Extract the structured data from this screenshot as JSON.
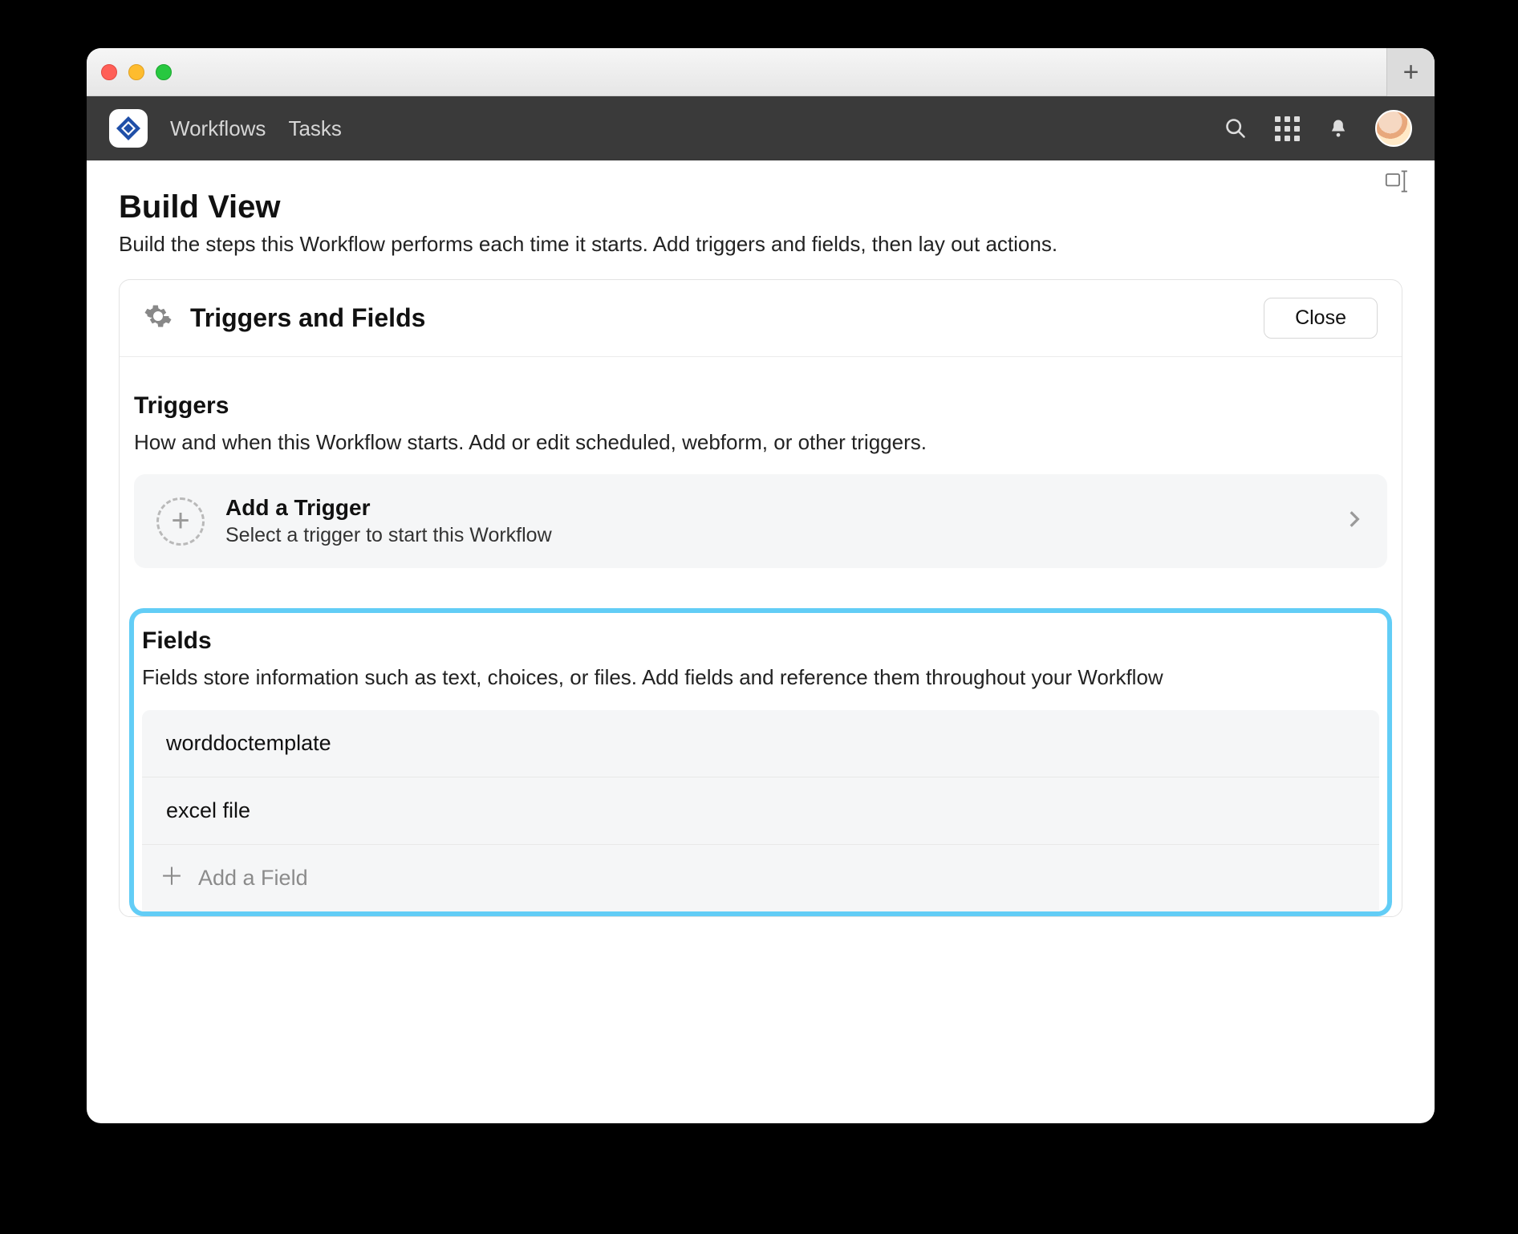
{
  "nav": {
    "workflows": "Workflows",
    "tasks": "Tasks"
  },
  "page": {
    "title": "Build View",
    "subtitle": "Build the steps this Workflow performs each time it starts. Add triggers and fields, then lay out actions."
  },
  "panel": {
    "title": "Triggers and Fields",
    "close": "Close"
  },
  "triggers": {
    "title": "Triggers",
    "subtitle": "How and when this Workflow starts. Add or edit scheduled, webform, or other triggers.",
    "add_title": "Add a Trigger",
    "add_subtitle": "Select a trigger to start this Workflow"
  },
  "fields": {
    "title": "Fields",
    "subtitle": "Fields store information such as text, choices, or files. Add fields and reference them throughout your Workflow",
    "items": [
      "worddoctemplate",
      "excel file"
    ],
    "add_label": "Add a Field"
  },
  "colors": {
    "highlight": "#62cdf6",
    "header_bg": "#3a3a3a"
  }
}
